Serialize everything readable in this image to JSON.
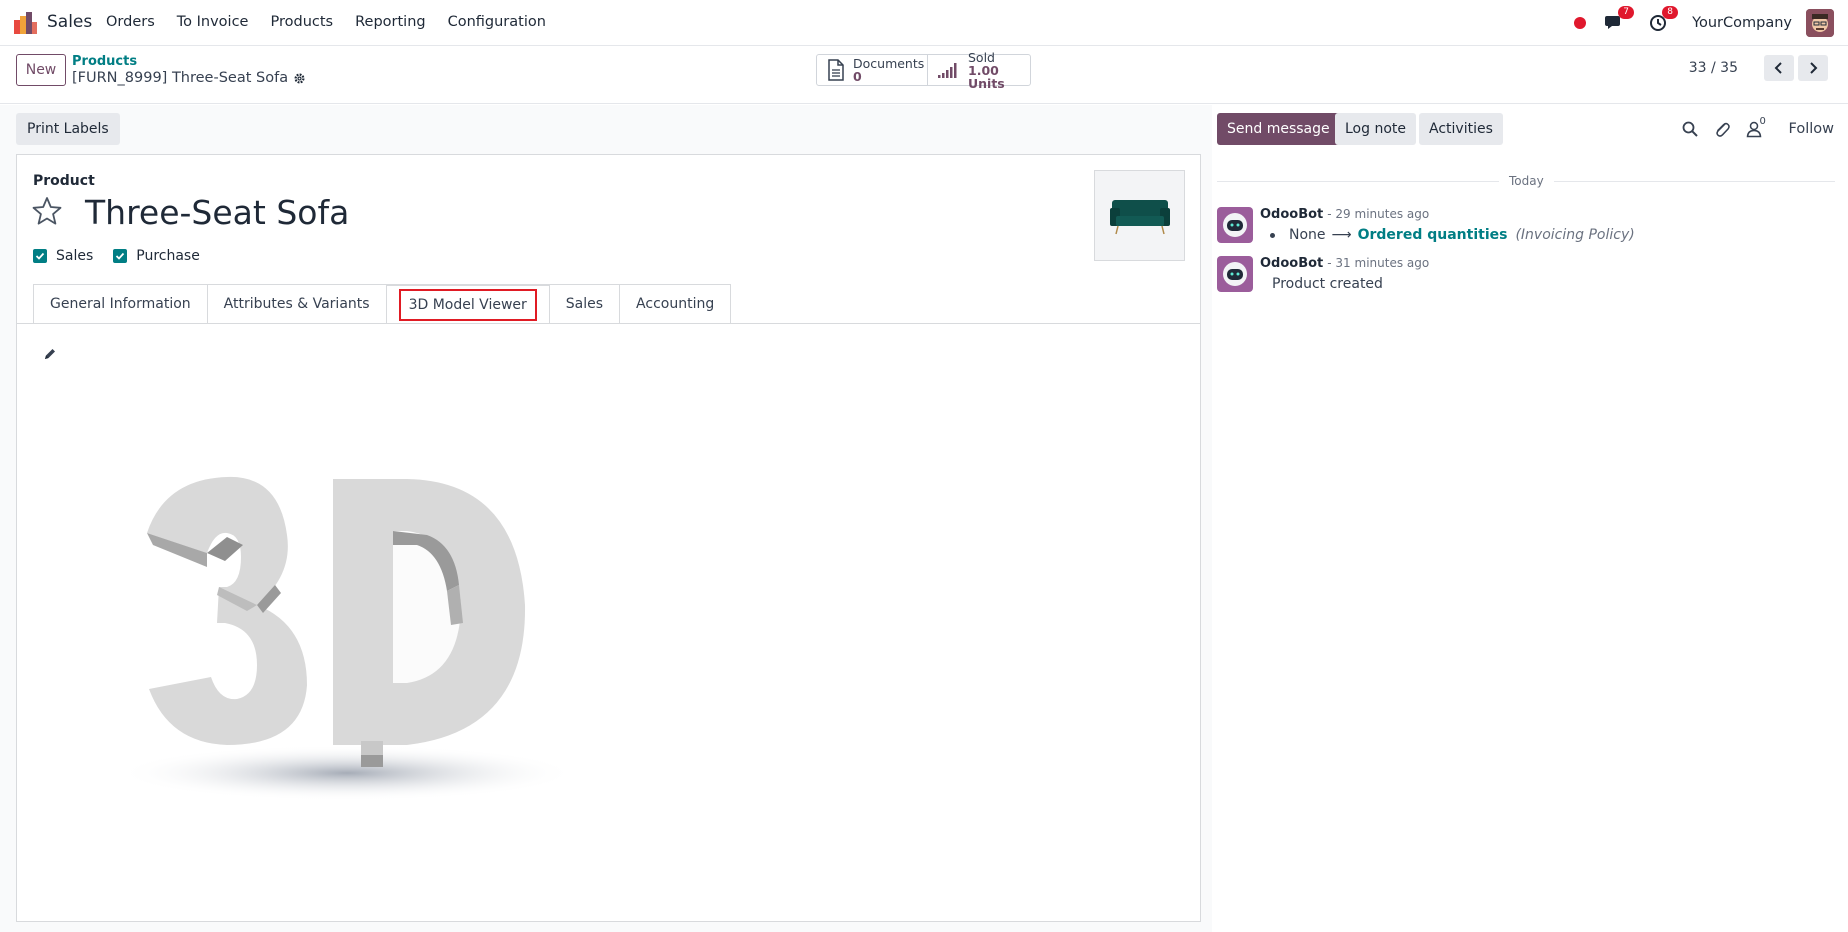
{
  "navbar": {
    "app_name": "Sales",
    "menu": [
      "Orders",
      "To Invoice",
      "Products",
      "Reporting",
      "Configuration"
    ],
    "messages_count": "7",
    "activities_count": "8",
    "company": "YourCompany"
  },
  "control_panel": {
    "new_label": "New",
    "breadcrumb_parent": "Products",
    "breadcrumb_current": "[FURN_8999] Three-Seat Sofa",
    "documents_label": "Documents",
    "documents_value": "0",
    "sold_label": "Sold",
    "sold_value": "1.00 Units",
    "pager": "33 / 35"
  },
  "form": {
    "print_labels": "Print Labels",
    "product_label": "Product",
    "product_name": "Three-Seat Sofa",
    "checkboxes": [
      {
        "label": "Sales",
        "checked": true
      },
      {
        "label": "Purchase",
        "checked": true
      }
    ],
    "tabs": [
      "General Information",
      "Attributes & Variants",
      "3D Model Viewer",
      "Sales",
      "Accounting"
    ],
    "active_tab": "3D Model Viewer"
  },
  "chatter": {
    "send_message": "Send message",
    "log_note": "Log note",
    "activities": "Activities",
    "followers_count": "0",
    "follow": "Follow",
    "date_separator": "Today",
    "messages": [
      {
        "author": "OdooBot",
        "time": "- 29 minutes ago",
        "old_value": "None",
        "new_value": "Ordered quantities",
        "field": "(Invoicing Policy)"
      },
      {
        "author": "OdooBot",
        "time": "- 31 minutes ago",
        "body": "Product created"
      }
    ]
  },
  "colors": {
    "brand": "#714b67",
    "accent": "#017e84",
    "badge": "#e0182d",
    "highlight": "#e01b24"
  }
}
